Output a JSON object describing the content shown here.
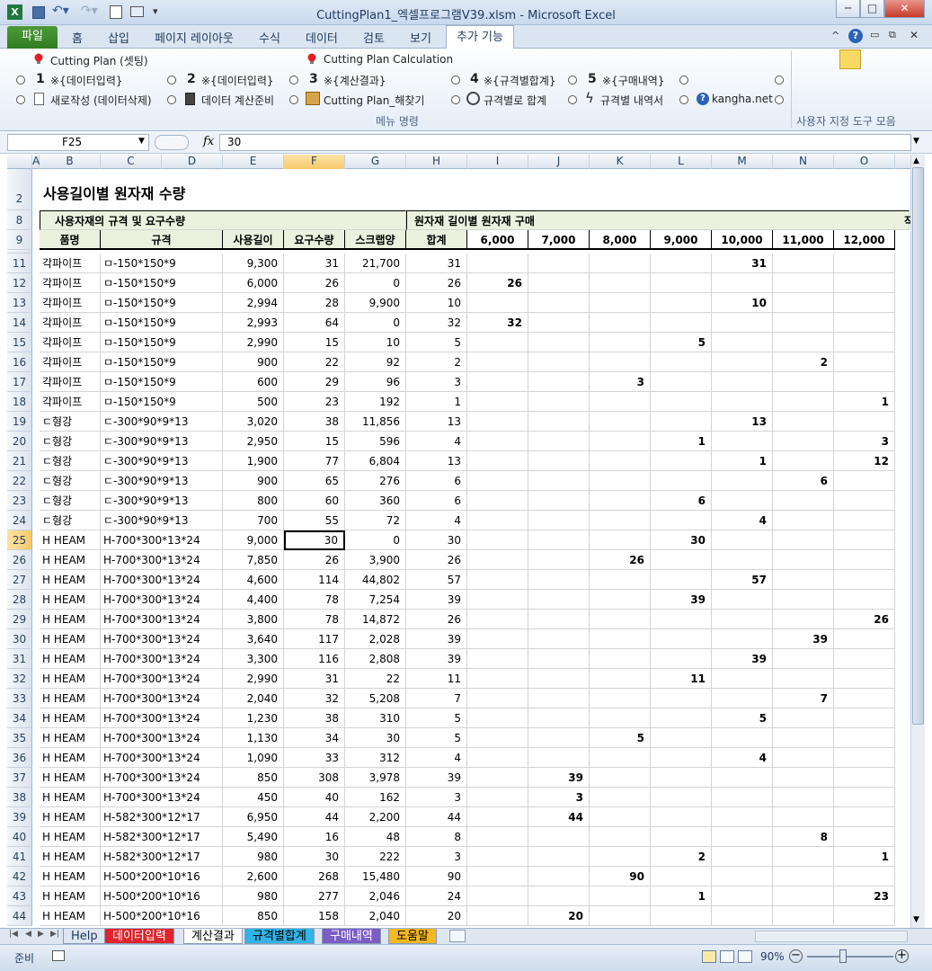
{
  "window": {
    "title": "CuttingPlan1_엑셀프로그램V39.xlsm  -  Microsoft Excel",
    "min": "─",
    "max": "□",
    "close": "✕"
  },
  "tabs": {
    "file": "파일",
    "items": [
      "홈",
      "삽입",
      "페이지 레이아웃",
      "수식",
      "데이터",
      "검토",
      "보기"
    ],
    "active": "추가 기능"
  },
  "ribbon": {
    "cp_setting": "Cutting Plan (셋팅)",
    "cp_calc": "Cutting Plan Calculation",
    "n1": "1",
    "t1": "※{데이터입력}",
    "n2": "2",
    "t2": "※{데이터입력}",
    "n3": "3",
    "t3": "※{계산결과}",
    "n4": "4",
    "t4": "※{규격별합계}",
    "n5": "5",
    "t5": "※{구매내역}",
    "new": "새로작성 (데이터삭제)",
    "prep": "데이터 계산준비",
    "solve": "Cutting Plan_해찾기",
    "sum": "규격별로 합계",
    "detail": "규격별 내역서",
    "site": "kangha.net",
    "group": "메뉴 명령",
    "custom": "사용자 지정 도구 모음"
  },
  "formula": {
    "name": "F25",
    "fx": "fx",
    "value": "30"
  },
  "cols": [
    "A",
    "B",
    "C",
    "D",
    "E",
    "F",
    "G",
    "H",
    "I",
    "J",
    "K",
    "L",
    "M",
    "N",
    "O"
  ],
  "sheet": {
    "title": "사용길이별 원자재 수량",
    "section1": "사용자재의 규격 및 요구수량",
    "section2": "원자재 길이별 원자재 구매",
    "section2_cut": "작",
    "headers": [
      "품명",
      "규격",
      "사용길이",
      "요구수량",
      "스크랩양",
      "합계",
      "6,000",
      "7,000",
      "8,000",
      "9,000",
      "10,000",
      "11,000",
      "12,000"
    ]
  },
  "rows": [
    {
      "n": "11",
      "name": "각파이프",
      "spec": "ㅁ-150*150*9",
      "len": "9,300",
      "req": "31",
      "scrap": "21,700",
      "sum": "31",
      "q": [
        "",
        "",
        "",
        "",
        "31",
        "",
        ""
      ]
    },
    {
      "n": "12",
      "name": "각파이프",
      "spec": "ㅁ-150*150*9",
      "len": "6,000",
      "req": "26",
      "scrap": "0",
      "sum": "26",
      "q": [
        "26",
        "",
        "",
        "",
        "",
        "",
        ""
      ]
    },
    {
      "n": "13",
      "name": "각파이프",
      "spec": "ㅁ-150*150*9",
      "len": "2,994",
      "req": "28",
      "scrap": "9,900",
      "sum": "10",
      "q": [
        "",
        "",
        "",
        "",
        "10",
        "",
        ""
      ]
    },
    {
      "n": "14",
      "name": "각파이프",
      "spec": "ㅁ-150*150*9",
      "len": "2,993",
      "req": "64",
      "scrap": "0",
      "sum": "32",
      "q": [
        "32",
        "",
        "",
        "",
        "",
        "",
        ""
      ]
    },
    {
      "n": "15",
      "name": "각파이프",
      "spec": "ㅁ-150*150*9",
      "len": "2,990",
      "req": "15",
      "scrap": "10",
      "sum": "5",
      "q": [
        "",
        "",
        "",
        "5",
        "",
        "",
        ""
      ]
    },
    {
      "n": "16",
      "name": "각파이프",
      "spec": "ㅁ-150*150*9",
      "len": "900",
      "req": "22",
      "scrap": "92",
      "sum": "2",
      "q": [
        "",
        "",
        "",
        "",
        "",
        "2",
        ""
      ]
    },
    {
      "n": "17",
      "name": "각파이프",
      "spec": "ㅁ-150*150*9",
      "len": "600",
      "req": "29",
      "scrap": "96",
      "sum": "3",
      "q": [
        "",
        "",
        "3",
        "",
        "",
        "",
        ""
      ]
    },
    {
      "n": "18",
      "name": "각파이프",
      "spec": "ㅁ-150*150*9",
      "len": "500",
      "req": "23",
      "scrap": "192",
      "sum": "1",
      "q": [
        "",
        "",
        "",
        "",
        "",
        "",
        "1"
      ]
    },
    {
      "n": "19",
      "name": "ㄷ형강",
      "spec": "ㄷ-300*90*9*13",
      "len": "3,020",
      "req": "38",
      "scrap": "11,856",
      "sum": "13",
      "q": [
        "",
        "",
        "",
        "",
        "13",
        "",
        ""
      ]
    },
    {
      "n": "20",
      "name": "ㄷ형강",
      "spec": "ㄷ-300*90*9*13",
      "len": "2,950",
      "req": "15",
      "scrap": "596",
      "sum": "4",
      "q": [
        "",
        "",
        "",
        "1",
        "",
        "",
        "3"
      ]
    },
    {
      "n": "21",
      "name": "ㄷ형강",
      "spec": "ㄷ-300*90*9*13",
      "len": "1,900",
      "req": "77",
      "scrap": "6,804",
      "sum": "13",
      "q": [
        "",
        "",
        "",
        "",
        "1",
        "",
        "12"
      ]
    },
    {
      "n": "22",
      "name": "ㄷ형강",
      "spec": "ㄷ-300*90*9*13",
      "len": "900",
      "req": "65",
      "scrap": "276",
      "sum": "6",
      "q": [
        "",
        "",
        "",
        "",
        "",
        "6",
        ""
      ]
    },
    {
      "n": "23",
      "name": "ㄷ형강",
      "spec": "ㄷ-300*90*9*13",
      "len": "800",
      "req": "60",
      "scrap": "360",
      "sum": "6",
      "q": [
        "",
        "",
        "",
        "6",
        "",
        "",
        ""
      ]
    },
    {
      "n": "24",
      "name": "ㄷ형강",
      "spec": "ㄷ-300*90*9*13",
      "len": "700",
      "req": "55",
      "scrap": "72",
      "sum": "4",
      "q": [
        "",
        "",
        "",
        "",
        "4",
        "",
        ""
      ]
    },
    {
      "n": "25",
      "name": "H HEAM",
      "spec": "H-700*300*13*24",
      "len": "9,000",
      "req": "30",
      "scrap": "0",
      "sum": "30",
      "q": [
        "",
        "",
        "",
        "30",
        "",
        "",
        ""
      ]
    },
    {
      "n": "26",
      "name": "H HEAM",
      "spec": "H-700*300*13*24",
      "len": "7,850",
      "req": "26",
      "scrap": "3,900",
      "sum": "26",
      "q": [
        "",
        "",
        "26",
        "",
        "",
        "",
        ""
      ]
    },
    {
      "n": "27",
      "name": "H HEAM",
      "spec": "H-700*300*13*24",
      "len": "4,600",
      "req": "114",
      "scrap": "44,802",
      "sum": "57",
      "q": [
        "",
        "",
        "",
        "",
        "57",
        "",
        ""
      ]
    },
    {
      "n": "28",
      "name": "H HEAM",
      "spec": "H-700*300*13*24",
      "len": "4,400",
      "req": "78",
      "scrap": "7,254",
      "sum": "39",
      "q": [
        "",
        "",
        "",
        "39",
        "",
        "",
        ""
      ]
    },
    {
      "n": "29",
      "name": "H HEAM",
      "spec": "H-700*300*13*24",
      "len": "3,800",
      "req": "78",
      "scrap": "14,872",
      "sum": "26",
      "q": [
        "",
        "",
        "",
        "",
        "",
        "",
        "26"
      ]
    },
    {
      "n": "30",
      "name": "H HEAM",
      "spec": "H-700*300*13*24",
      "len": "3,640",
      "req": "117",
      "scrap": "2,028",
      "sum": "39",
      "q": [
        "",
        "",
        "",
        "",
        "",
        "39",
        ""
      ]
    },
    {
      "n": "31",
      "name": "H HEAM",
      "spec": "H-700*300*13*24",
      "len": "3,300",
      "req": "116",
      "scrap": "2,808",
      "sum": "39",
      "q": [
        "",
        "",
        "",
        "",
        "39",
        "",
        ""
      ]
    },
    {
      "n": "32",
      "name": "H HEAM",
      "spec": "H-700*300*13*24",
      "len": "2,990",
      "req": "31",
      "scrap": "22",
      "sum": "11",
      "q": [
        "",
        "",
        "",
        "11",
        "",
        "",
        ""
      ]
    },
    {
      "n": "33",
      "name": "H HEAM",
      "spec": "H-700*300*13*24",
      "len": "2,040",
      "req": "32",
      "scrap": "5,208",
      "sum": "7",
      "q": [
        "",
        "",
        "",
        "",
        "",
        "7",
        ""
      ]
    },
    {
      "n": "34",
      "name": "H HEAM",
      "spec": "H-700*300*13*24",
      "len": "1,230",
      "req": "38",
      "scrap": "310",
      "sum": "5",
      "q": [
        "",
        "",
        "",
        "",
        "5",
        "",
        ""
      ]
    },
    {
      "n": "35",
      "name": "H HEAM",
      "spec": "H-700*300*13*24",
      "len": "1,130",
      "req": "34",
      "scrap": "30",
      "sum": "5",
      "q": [
        "",
        "",
        "5",
        "",
        "",
        "",
        ""
      ]
    },
    {
      "n": "36",
      "name": "H HEAM",
      "spec": "H-700*300*13*24",
      "len": "1,090",
      "req": "33",
      "scrap": "312",
      "sum": "4",
      "q": [
        "",
        "",
        "",
        "",
        "4",
        "",
        ""
      ]
    },
    {
      "n": "37",
      "name": "H HEAM",
      "spec": "H-700*300*13*24",
      "len": "850",
      "req": "308",
      "scrap": "3,978",
      "sum": "39",
      "q": [
        "",
        "39",
        "",
        "",
        "",
        "",
        ""
      ]
    },
    {
      "n": "38",
      "name": "H HEAM",
      "spec": "H-700*300*13*24",
      "len": "450",
      "req": "40",
      "scrap": "162",
      "sum": "3",
      "q": [
        "",
        "3",
        "",
        "",
        "",
        "",
        ""
      ]
    },
    {
      "n": "39",
      "name": "H HEAM",
      "spec": "H-582*300*12*17",
      "len": "6,950",
      "req": "44",
      "scrap": "2,200",
      "sum": "44",
      "q": [
        "",
        "44",
        "",
        "",
        "",
        "",
        ""
      ]
    },
    {
      "n": "40",
      "name": "H HEAM",
      "spec": "H-582*300*12*17",
      "len": "5,490",
      "req": "16",
      "scrap": "48",
      "sum": "8",
      "q": [
        "",
        "",
        "",
        "",
        "",
        "8",
        ""
      ]
    },
    {
      "n": "41",
      "name": "H HEAM",
      "spec": "H-582*300*12*17",
      "len": "980",
      "req": "30",
      "scrap": "222",
      "sum": "3",
      "q": [
        "",
        "",
        "",
        "2",
        "",
        "",
        "1"
      ]
    },
    {
      "n": "42",
      "name": "H HEAM",
      "spec": "H-500*200*10*16",
      "len": "2,600",
      "req": "268",
      "scrap": "15,480",
      "sum": "90",
      "q": [
        "",
        "",
        "90",
        "",
        "",
        "",
        ""
      ]
    },
    {
      "n": "43",
      "name": "H HEAM",
      "spec": "H-500*200*10*16",
      "len": "980",
      "req": "277",
      "scrap": "2,046",
      "sum": "24",
      "q": [
        "",
        "",
        "",
        "1",
        "",
        "",
        "23"
      ]
    },
    {
      "n": "44",
      "name": "H HEAM",
      "spec": "H-500*200*10*16",
      "len": "850",
      "req": "158",
      "scrap": "2,040",
      "sum": "20",
      "q": [
        "",
        "20",
        "",
        "",
        "",
        "",
        ""
      ]
    }
  ],
  "sheettabs": [
    {
      "label": "Help",
      "bg": "#dde6f1",
      "fg": "#1e395b"
    },
    {
      "label": "데이터입력",
      "bg": "#e0242c",
      "fg": "#ffffff"
    },
    {
      "label": "계산결과",
      "bg": "#ffffff",
      "fg": "#000000"
    },
    {
      "label": "규격별합계",
      "bg": "#33b3e6",
      "fg": "#000000"
    },
    {
      "label": "구매내역",
      "bg": "#7b5ec5",
      "fg": "#ffffff"
    },
    {
      "label": "도움말",
      "bg": "#f5b820",
      "fg": "#000000"
    }
  ],
  "status": {
    "ready": "준비",
    "zoom": "90%"
  },
  "colors": {
    "selected": "#000000",
    "header_fill": "#ebf1de"
  }
}
